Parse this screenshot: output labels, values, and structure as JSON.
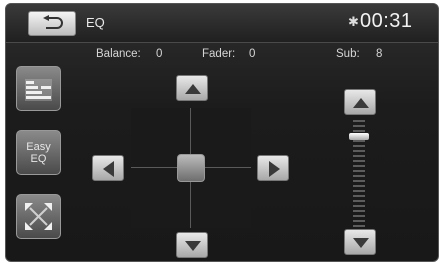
{
  "header": {
    "title": "EQ",
    "bluetooth_icon": "bluetooth-icon",
    "time": "00:31"
  },
  "status": {
    "balance_label": "Balance:",
    "balance_value": "0",
    "fader_label": "Fader:",
    "fader_value": "0",
    "sub_label": "Sub:",
    "sub_value": "8"
  },
  "sidebar": {
    "items": [
      {
        "icon": "equalizer-bars-icon"
      },
      {
        "label_line1": "Easy",
        "label_line2": "EQ"
      },
      {
        "icon": "speaker-position-icon"
      }
    ]
  },
  "sub_slider": {
    "level": 8
  }
}
